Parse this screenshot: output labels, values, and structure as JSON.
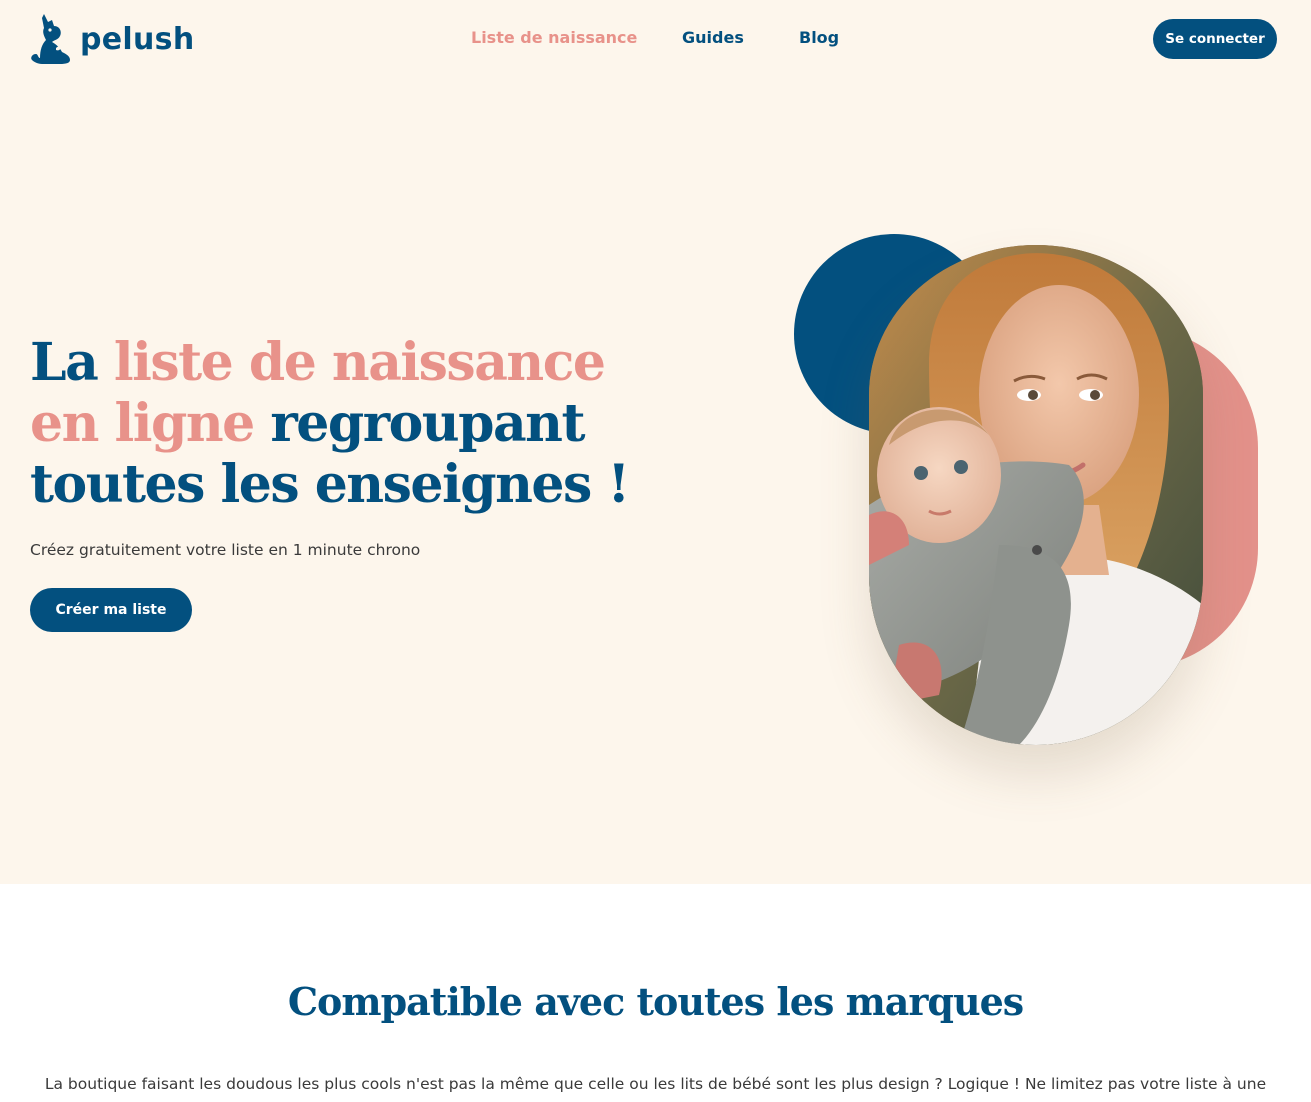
{
  "brand": {
    "name": "pelush",
    "logo_icon": "kangaroo-icon"
  },
  "nav": {
    "items": [
      {
        "label": "Liste de naissance",
        "active": true
      },
      {
        "label": "Guides",
        "active": false
      },
      {
        "label": "Blog",
        "active": false
      }
    ],
    "login_label": "Se connecter"
  },
  "hero": {
    "title_parts": {
      "part1": "La ",
      "part2": "liste de naissance en ligne",
      "part3": " regroupant toutes les enseignes !"
    },
    "subtitle": "Créez gratuitement votre liste en 1 minute chrono",
    "cta_label": "Créer ma liste",
    "image_subject": "mother-with-baby-in-sling"
  },
  "section2": {
    "title": "Compatible avec toutes les marques",
    "text": "La boutique faisant les doudous les plus cools n'est pas la même que celle ou les lits de bébé sont les plus design ? Logique ! Ne limitez pas votre liste à une"
  },
  "colors": {
    "primary": "#03507f",
    "accent": "#e8928a",
    "hero_bg": "#fdf6ec",
    "page_bg": "#ffffff"
  }
}
